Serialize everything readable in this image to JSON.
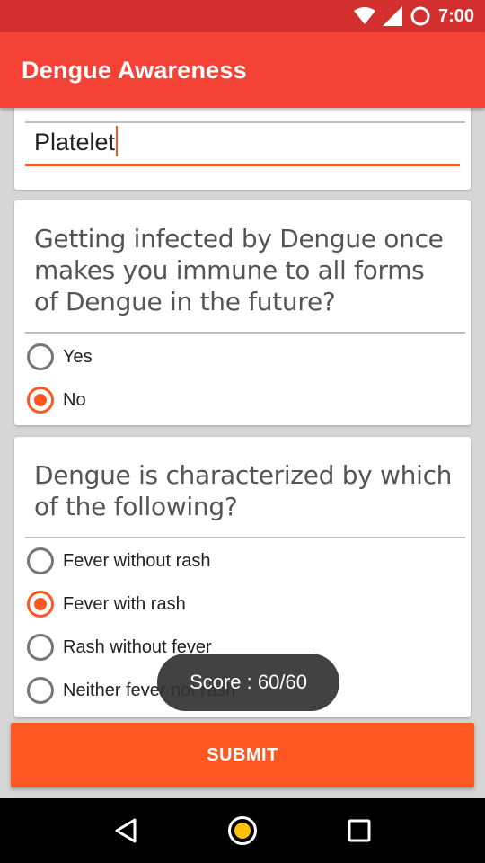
{
  "status_bar": {
    "time": "7:00",
    "icons": [
      "wifi-icon",
      "signal-icon",
      "battery-icon"
    ],
    "background": "#d32f2f"
  },
  "app_bar": {
    "title": "Dengue Awareness",
    "background": "#f44336"
  },
  "answer_card": {
    "input_value": "Platelet"
  },
  "question_2": {
    "text": "Getting infected by Dengue once makes you immune to all forms of Dengue in the future?",
    "options": [
      {
        "label": "Yes",
        "checked": false
      },
      {
        "label": "No",
        "checked": true
      }
    ]
  },
  "question_3": {
    "text": "Dengue is characterized by which of the following?",
    "options": [
      {
        "label": "Fever without rash",
        "checked": false
      },
      {
        "label": "Fever with rash",
        "checked": true
      },
      {
        "label": "Rash without fever",
        "checked": false
      },
      {
        "label": "Neither fever not rash",
        "checked": false
      }
    ]
  },
  "submit": {
    "label": "SUBMIT",
    "color": "#ff5722"
  },
  "toast": {
    "text": "Score : 60/60"
  },
  "nav_bar": {
    "icons": [
      "back-icon",
      "home-icon",
      "recents-icon"
    ]
  },
  "accent_color": "#ff5722"
}
